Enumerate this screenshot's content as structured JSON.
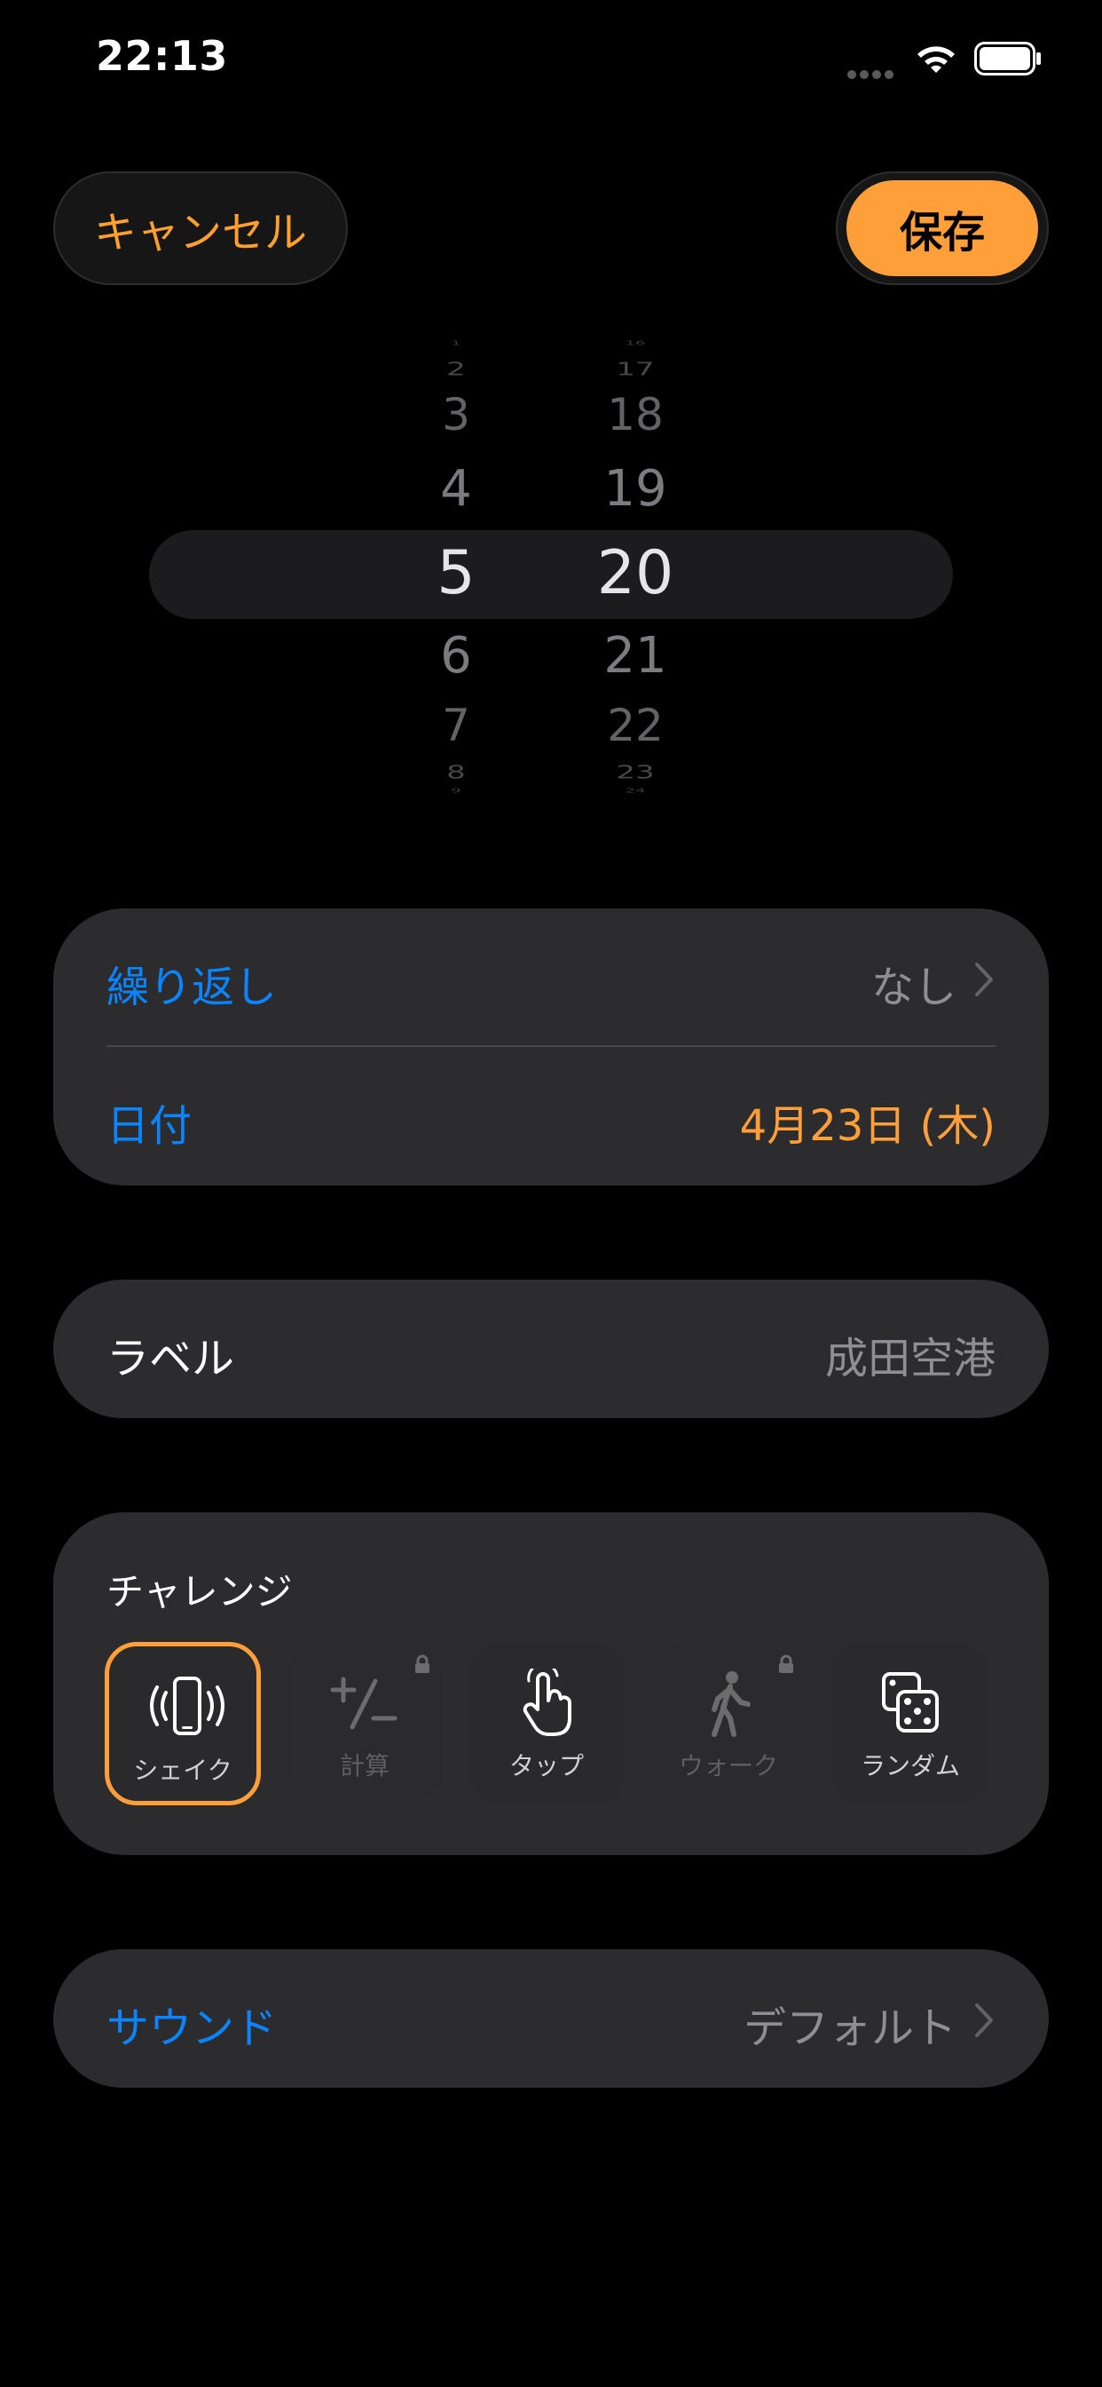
{
  "status_bar": {
    "time": "22:13"
  },
  "header": {
    "cancel_label": "キャンセル",
    "save_label": "保存"
  },
  "picker": {
    "hours": [
      "1",
      "2",
      "3",
      "4",
      "5",
      "6",
      "7",
      "8",
      "9"
    ],
    "minutes": [
      "16",
      "17",
      "18",
      "19",
      "20",
      "21",
      "22",
      "23",
      "24"
    ],
    "selected_hour": "5",
    "selected_minute": "20"
  },
  "schedule": {
    "repeat_label": "繰り返し",
    "repeat_value": "なし",
    "date_label": "日付",
    "date_value": "4月23日 (木)"
  },
  "label_row": {
    "label": "ラベル",
    "value": "成田空港"
  },
  "challenge": {
    "title": "チャレンジ",
    "items": [
      {
        "label": "シェイク",
        "icon": "shake-phone-icon",
        "selected": true,
        "locked": false
      },
      {
        "label": "計算",
        "icon": "plus-minus-icon",
        "selected": false,
        "locked": true
      },
      {
        "label": "タップ",
        "icon": "tap-hand-icon",
        "selected": false,
        "locked": false
      },
      {
        "label": "ウォーク",
        "icon": "walk-icon",
        "selected": false,
        "locked": true
      },
      {
        "label": "ランダム",
        "icon": "dice-icon",
        "selected": false,
        "locked": false
      }
    ]
  },
  "sound_row": {
    "label": "サウンド",
    "value": "デフォルト"
  },
  "colors": {
    "accent_orange": "#ff9f3a",
    "accent_blue": "#0a84ff",
    "card_bg": "#2c2c2e"
  }
}
